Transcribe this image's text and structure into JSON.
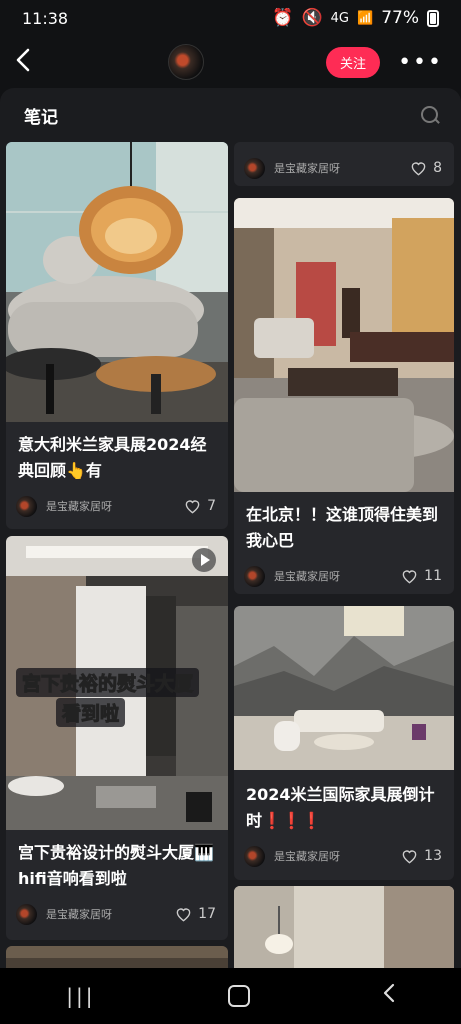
{
  "status": {
    "time": "11:38",
    "net": "4G",
    "battery": "77%"
  },
  "header": {
    "back_icon": "chevron-left-icon",
    "follow_label": "关注",
    "more_icon": "more-horizontal-icon"
  },
  "panel": {
    "title": "笔记",
    "search_icon": "search-icon"
  },
  "colors": {
    "accent": "#fe2c55",
    "background": "#111214",
    "panel": "#1b1c1f",
    "card": "#26272b"
  },
  "left_column": [
    {
      "title": "意大利米兰家具展2024经典回顾👆有",
      "author": "是宝藏家居呀",
      "likes": "7",
      "image": "living room with artichoke pendant lamp and round side tables"
    },
    {
      "title": "宫下贵裕设计的熨斗大厦🎹hifi音响看到啦",
      "author": "是宝藏家居呀",
      "likes": "17",
      "overlay_line1": "宫下贵裕的熨斗大厦",
      "overlay_line2": "看到啦",
      "is_video": true
    }
  ],
  "right_column": [
    {
      "author": "是宝藏家居呀",
      "likes": "8"
    },
    {
      "title": "在北京！！这谁顶得住美到我心巴",
      "author": "是宝藏家居呀",
      "likes": "11"
    },
    {
      "title": "2024米兰国际家具展倒计时❗❗❗",
      "author": "是宝藏家居呀",
      "likes": "13"
    }
  ]
}
